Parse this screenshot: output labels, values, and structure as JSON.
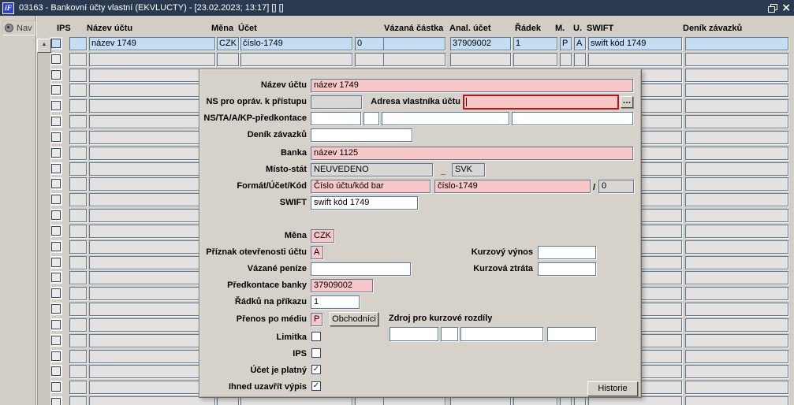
{
  "icons": {
    "scroll_up": "▲",
    "more": "…",
    "check": "✓"
  },
  "window": {
    "icon_label": "iF",
    "title": "03163 - Bankovní účty vlastní (EKVLUCTY) - [23.02.2023; 13:17] [] []",
    "close_glyph": "×"
  },
  "sidebar": {
    "nav_label": "Nav"
  },
  "table": {
    "headers": [
      "IPS",
      "Název účtu",
      "Měna",
      "Účet",
      "Vázaná částka",
      "Anal. účet",
      "Řádek",
      "M.",
      "U.",
      "SWIFT",
      "Deník závazků"
    ],
    "row_count": 24,
    "first_row": {
      "sel": "",
      "nazev": "název 1749",
      "mena": "CZK",
      "ucet": "číslo-1749",
      "kod": "0",
      "vazana": "",
      "anal": "37909002",
      "radek": "1",
      "m": "P",
      "u": "A",
      "swift": "swift kód 1749",
      "denik": ""
    }
  },
  "detail": {
    "nazev_uctu": {
      "label": "Název účtu",
      "value": "název 1749"
    },
    "ns_opravneni": {
      "label": "NS pro opráv. k přístupu",
      "value": ""
    },
    "adresa": {
      "label": "Adresa vlastníka účtu",
      "value": ""
    },
    "predkontace": {
      "label": "NS/TA/A/KP-předkontace",
      "v1": "",
      "v2": "",
      "v3": "",
      "v4": ""
    },
    "denik_zavazku": {
      "label": "Deník závazků",
      "value": ""
    },
    "banka": {
      "label": "Banka",
      "value": "název 1125"
    },
    "misto_stat": {
      "label": "Místo-stát",
      "value1": "NEUVEDENO",
      "separator": "_",
      "value2": "SVK"
    },
    "format_ucet_kod": {
      "label": "Formát/Účet/Kód",
      "format": "Číslo účtu/kód bar",
      "ucet": "číslo-1749",
      "slash": "/",
      "kod": "0"
    },
    "swift": {
      "label": "SWIFT",
      "value": "swift kód 1749"
    },
    "mena": {
      "label": "Měna",
      "value": "CZK"
    },
    "priznak_otevrenosti": {
      "label": "Příznak otevřenosti účtu",
      "value": "A"
    },
    "kurzovy_vynos": {
      "label": "Kurzový výnos",
      "value": ""
    },
    "vazane_penize": {
      "label": "Vázané peníze",
      "value": ""
    },
    "kurzova_ztrata": {
      "label": "Kurzová ztráta",
      "value": ""
    },
    "predkontace_banky": {
      "label": "Předkontace banky",
      "value": "37909002"
    },
    "radku_na_prikazu": {
      "label": "Řádků na příkazu",
      "value": "1"
    },
    "prenos_po_mediu": {
      "label": "Přenos po médiu",
      "value": "P"
    },
    "obchodnici_button": "Obchodníci",
    "zdroj": {
      "label": "Zdroj pro kurzové rozdíly",
      "v1": "",
      "v2": "",
      "v3": "",
      "v4": ""
    },
    "limitka": {
      "label": "Limitka",
      "checked": false
    },
    "ips": {
      "label": "IPS",
      "checked": false
    },
    "ucet_je_platny": {
      "label": "Účet je platný",
      "checked": true
    },
    "ihned_uzavrit_vypis": {
      "label": "Ihned uzavřít výpis",
      "checked": true
    },
    "historie_button": "Historie"
  }
}
